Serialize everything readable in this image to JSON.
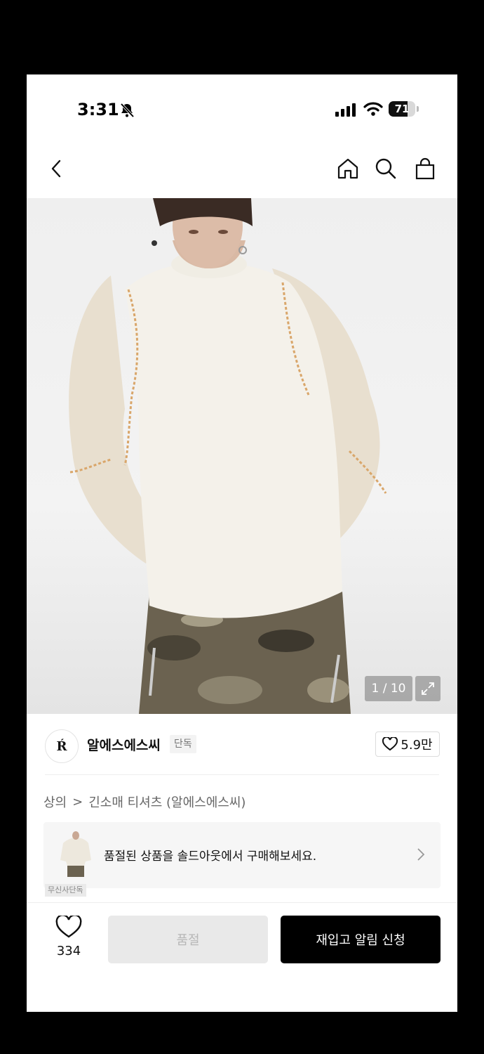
{
  "status_bar": {
    "time": "3:31",
    "battery": "71",
    "battery_level": 0.71
  },
  "nav": {
    "back_icon": "chevron-left-icon",
    "home_icon": "home-icon",
    "search_icon": "search-icon",
    "bag_icon": "bag-icon"
  },
  "product": {
    "image_counter": "1 / 10"
  },
  "brand": {
    "logo_text": "Ŕ",
    "name": "알에스에스씨",
    "badge": "단독",
    "likes": "5.9만"
  },
  "breadcrumb": {
    "category": "상의",
    "separator": ">",
    "subcategory": "긴소매 티셔츠 (알에스에스씨)"
  },
  "banner": {
    "text": "품절된 상품을 솔드아웃에서 구매해보세요.",
    "tag": "무신사단독"
  },
  "bottom": {
    "wish_count": "334",
    "soldout_label": "품절",
    "restock_label": "재입고 알림 신청"
  }
}
